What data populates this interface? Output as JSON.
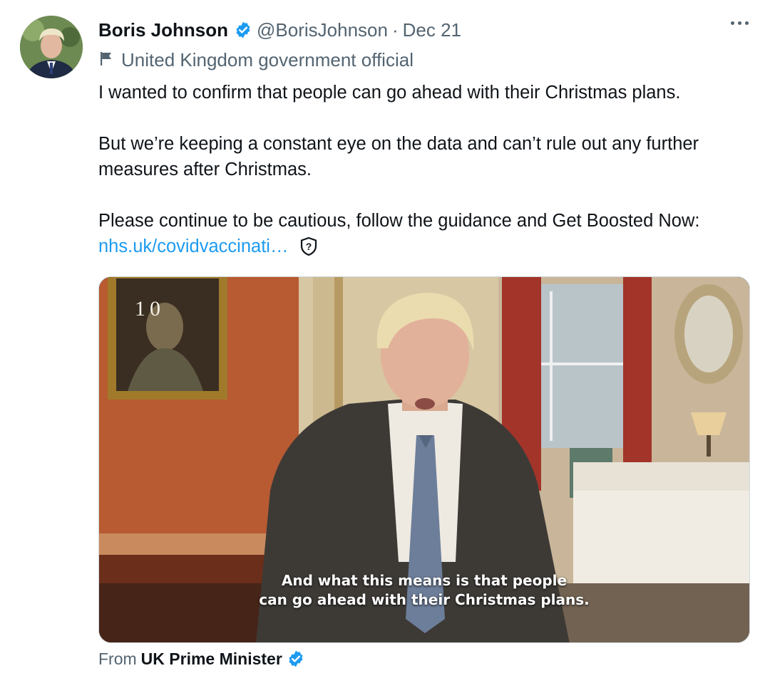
{
  "tweet": {
    "author_name": "Boris Johnson",
    "handle": "@BorisJohnson",
    "separator": "·",
    "date": "Dec 21",
    "account_label": "United Kingdom government official",
    "paragraphs": [
      "I wanted to confirm that people can go ahead with their Christmas plans.",
      "But we’re keeping a constant eye on the data and can’t rule out any further measures after Christmas.",
      "Please continue to be cautious, follow the guidance and Get Boosted Now:"
    ],
    "link_text": "nhs.uk/covidvaccinati…"
  },
  "media": {
    "logo_text": "10",
    "caption_line1": "And what this means is that people",
    "caption_line2": "can go ahead with their Christmas plans."
  },
  "source": {
    "from_label": "From",
    "from_name": "UK Prime Minister"
  },
  "icons": {
    "verified": "verified-badge-icon",
    "flag": "government-flag-icon",
    "more": "more-options-icon",
    "warning": "link-warning-shield-icon"
  },
  "colors": {
    "link": "#1d9bf0",
    "verified": "#1d9bf0",
    "secondary_text": "#536471",
    "primary_text": "#0f1419"
  }
}
